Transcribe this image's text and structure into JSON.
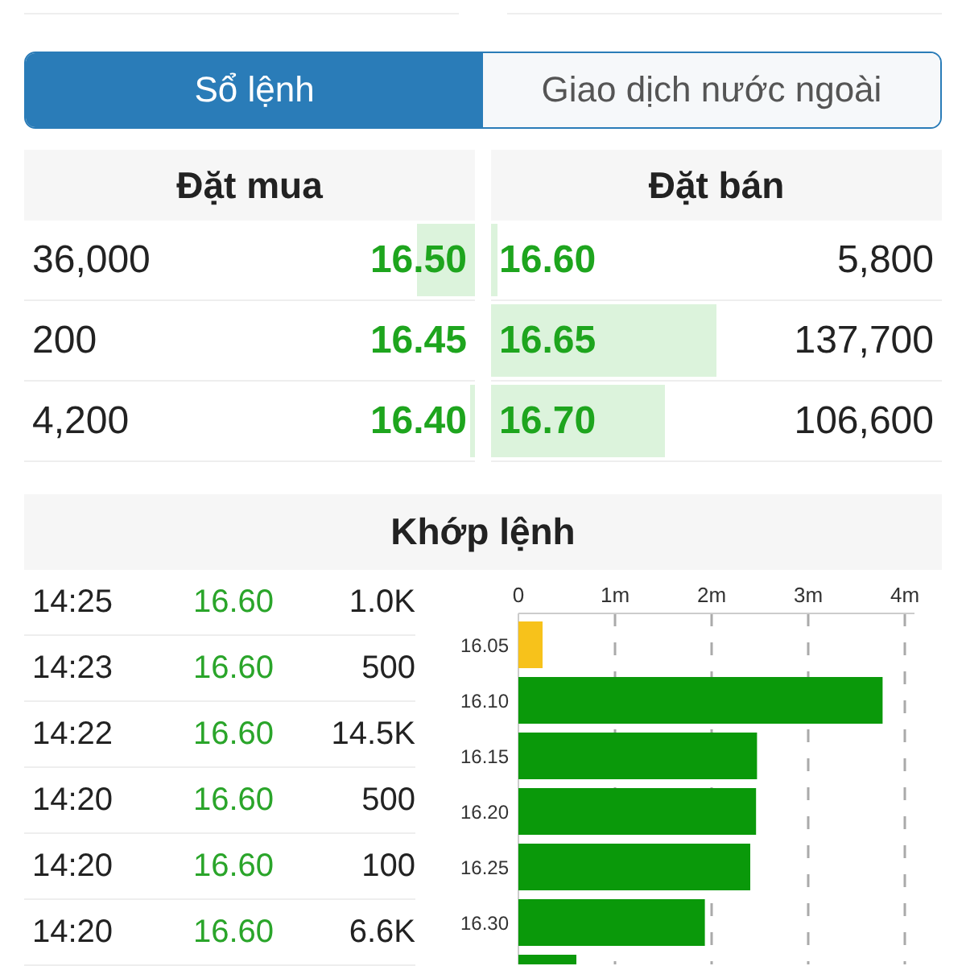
{
  "tabs": [
    {
      "label": "Sổ lệnh",
      "selected": true
    },
    {
      "label": "Giao dịch nước ngoài",
      "selected": false
    }
  ],
  "order_book": {
    "bid_title": "Đặt mua",
    "ask_title": "Đặt bán",
    "rows": [
      {
        "bid_volume": "36,000",
        "bid_price": "16.50",
        "bid_depth": {
          "level": 0.13
        },
        "ask_price": "16.60",
        "ask_depth": {
          "level": 0.015
        },
        "ask_volume": "5,800"
      },
      {
        "bid_volume": "200",
        "bid_price": "16.45",
        "ask_price": "16.65",
        "ask_depth": {
          "level": 0.5
        },
        "ask_volume": "137,700"
      },
      {
        "bid_volume": "4,200",
        "bid_price": "16.40",
        "bid_depth": {
          "level": 0.012
        },
        "ask_price": "16.70",
        "ask_depth": {
          "level": 0.385
        },
        "ask_volume": "106,600"
      }
    ]
  },
  "matched": {
    "title": "Khớp lệnh",
    "trades": [
      {
        "time": "14:25",
        "price": "16.60",
        "volume": "1.0K"
      },
      {
        "time": "14:23",
        "price": "16.60",
        "volume": "500"
      },
      {
        "time": "14:22",
        "price": "16.60",
        "volume": "14.5K"
      },
      {
        "time": "14:20",
        "price": "16.60",
        "volume": "500"
      },
      {
        "time": "14:20",
        "price": "16.60",
        "volume": "100"
      },
      {
        "time": "14:20",
        "price": "16.60",
        "volume": "6.6K"
      }
    ],
    "chart_data": {
      "type": "bar",
      "orientation": "horizontal",
      "categories": [
        "16.05",
        "16.10",
        "16.15",
        "16.20",
        "16.25",
        "16.30",
        null
      ],
      "grid": true,
      "series": [
        {
          "values": [
            0.25,
            3.77,
            2.47,
            2.46,
            2.4,
            1.93,
            0.6
          ]
        }
      ],
      "colors": [
        "#f7c21b",
        "#0a990a",
        "#0a990a",
        "#0a990a",
        "#0a990a",
        "#0a990a",
        "#0a990a"
      ],
      "xlim": [
        0,
        4
      ],
      "xticks": [
        {
          "value": 0,
          "label": "0"
        },
        {
          "value": 1,
          "label": "1m"
        },
        {
          "value": 2,
          "label": "2m"
        },
        {
          "value": 3,
          "label": "3m"
        },
        {
          "value": 4,
          "label": "4m"
        }
      ]
    }
  }
}
